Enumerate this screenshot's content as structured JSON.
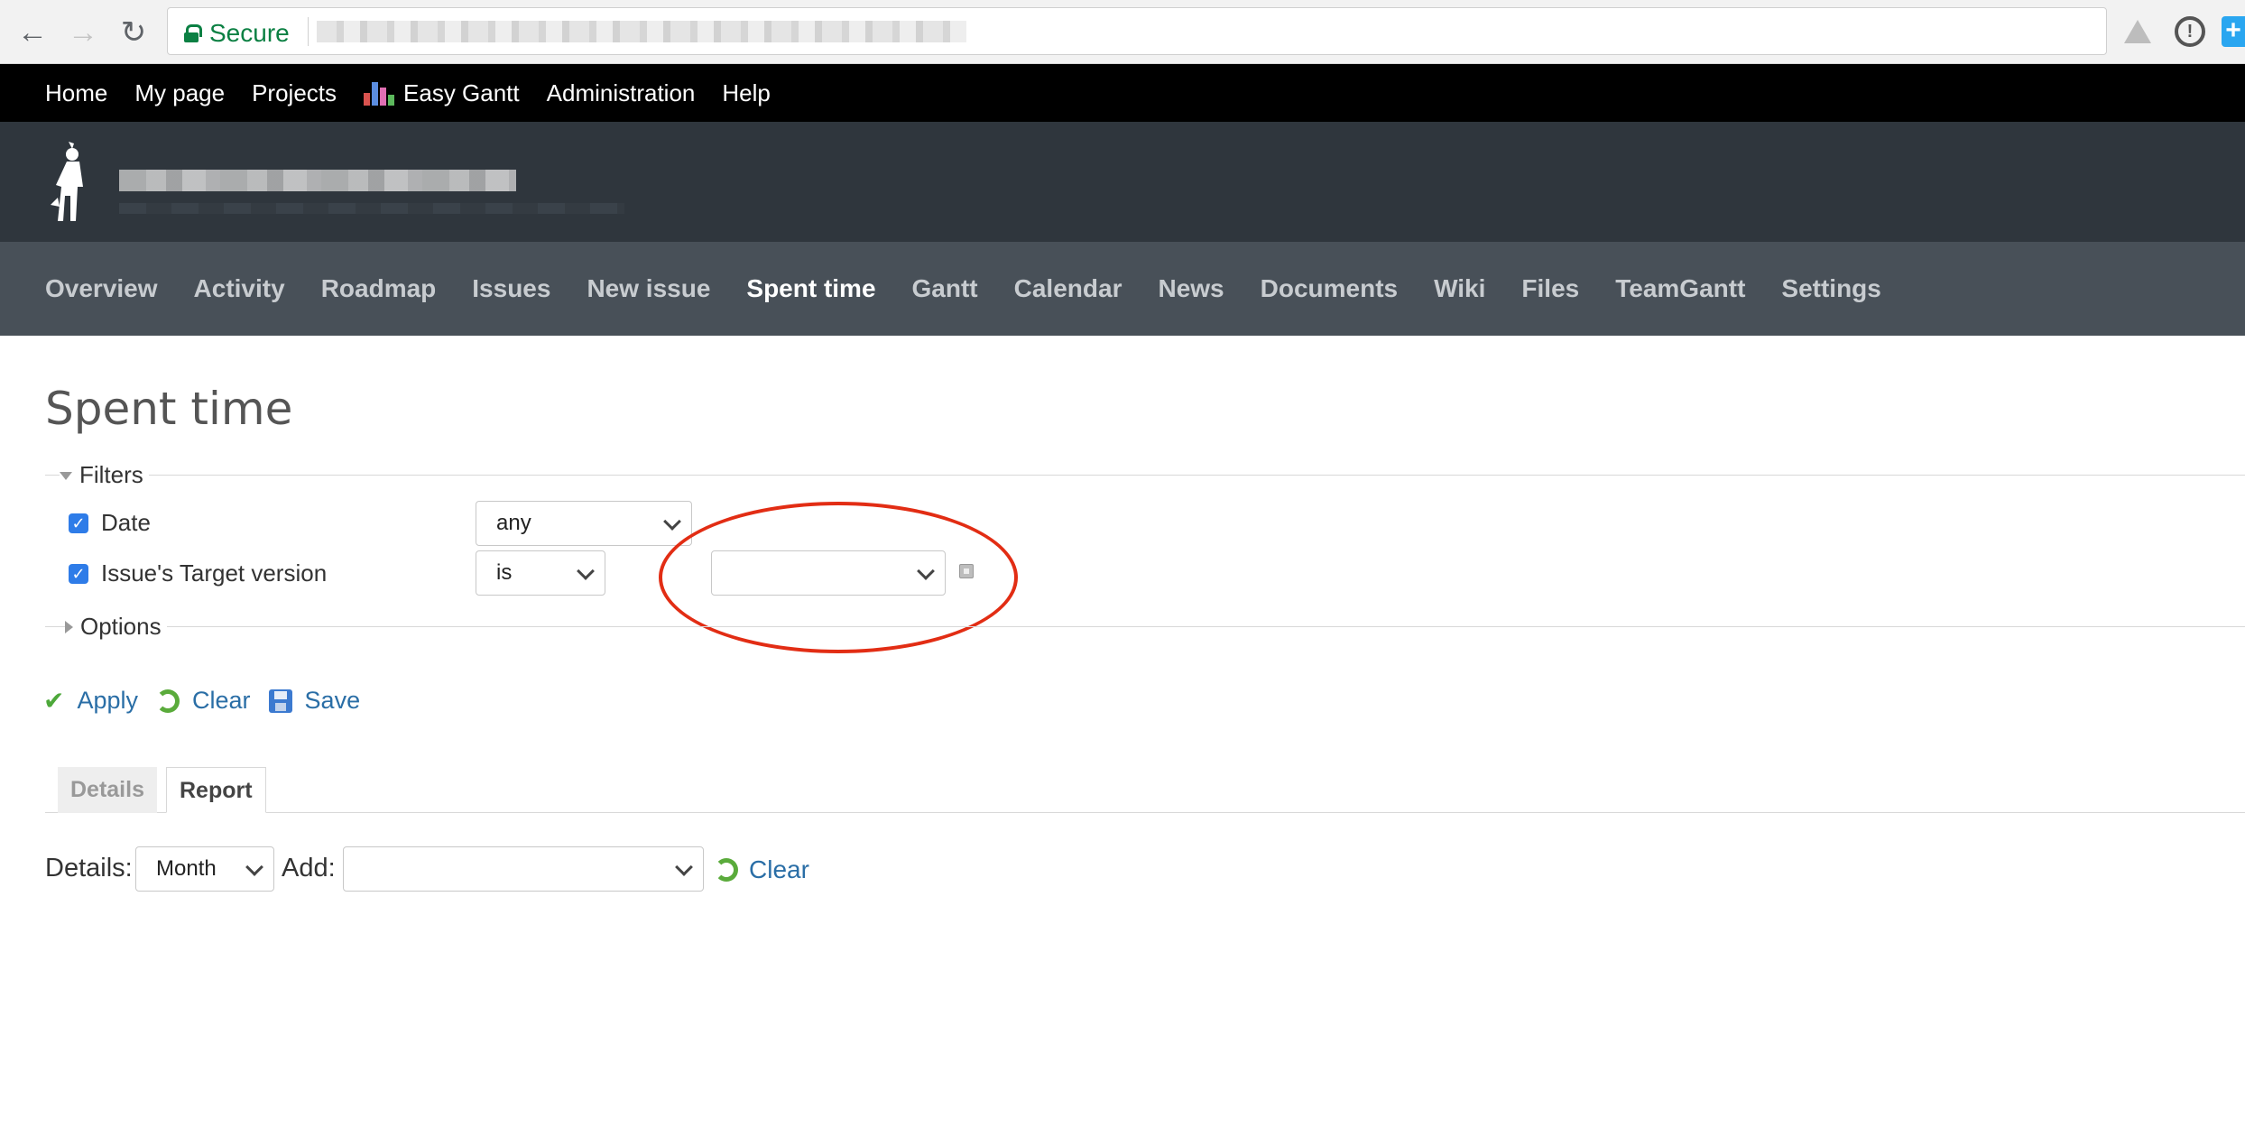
{
  "browser": {
    "secure_label": "Secure"
  },
  "topmenu": {
    "items": [
      "Home",
      "My page",
      "Projects",
      "Easy Gantt",
      "Administration",
      "Help"
    ]
  },
  "projmenu": {
    "items": [
      "Overview",
      "Activity",
      "Roadmap",
      "Issues",
      "New issue",
      "Spent time",
      "Gantt",
      "Calendar",
      "News",
      "Documents",
      "Wiki",
      "Files",
      "TeamGantt",
      "Settings"
    ],
    "selected": "Spent time"
  },
  "page": {
    "title": "Spent time"
  },
  "filters": {
    "legend": "Filters",
    "date": {
      "label": "Date",
      "checked": true,
      "operator": "any"
    },
    "target_version": {
      "label": "Issue's Target version",
      "checked": true,
      "operator": "is",
      "value": ""
    }
  },
  "options": {
    "legend": "Options"
  },
  "actions": {
    "apply": "Apply",
    "clear": "Clear",
    "save": "Save"
  },
  "tabs": {
    "details": "Details",
    "report": "Report",
    "active": "Report"
  },
  "report": {
    "details_label": "Details:",
    "details_value": "Month",
    "add_label": "Add:",
    "add_value": "",
    "clear": "Clear"
  },
  "colors": {
    "top_bar": "#000000",
    "header": "#2f363d",
    "project_menu": "#485058",
    "link": "#2a6ea6",
    "annotation": "#e22d14",
    "checkbox": "#2e7ce8"
  }
}
